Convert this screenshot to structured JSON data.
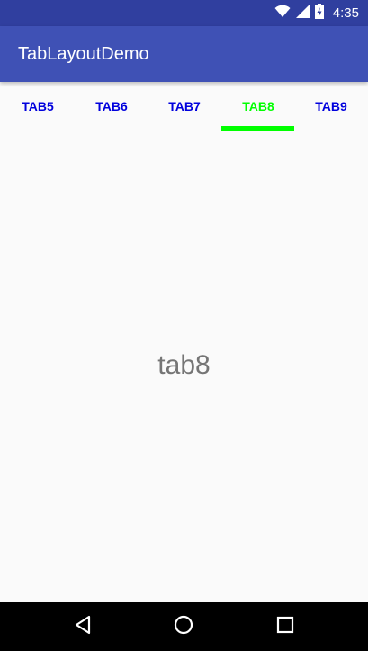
{
  "status_bar": {
    "time": "4:35",
    "icons": [
      "wifi-icon",
      "signal-icon",
      "battery-charging-icon"
    ]
  },
  "app_bar": {
    "title": "TabLayoutDemo"
  },
  "tabs": [
    {
      "label": "TAB5",
      "selected": false
    },
    {
      "label": "TAB6",
      "selected": false
    },
    {
      "label": "TAB7",
      "selected": false
    },
    {
      "label": "TAB8",
      "selected": true
    },
    {
      "label": "TAB9",
      "selected": false
    }
  ],
  "content": {
    "text": "tab8"
  },
  "nav_bar": {
    "buttons": [
      "back-icon",
      "home-icon",
      "recents-icon"
    ]
  },
  "colors": {
    "status_bar": "#303f9f",
    "app_bar": "#3f51b5",
    "tab_text": "#0000dd",
    "tab_selected": "#00ff00",
    "content_text": "#757575"
  }
}
